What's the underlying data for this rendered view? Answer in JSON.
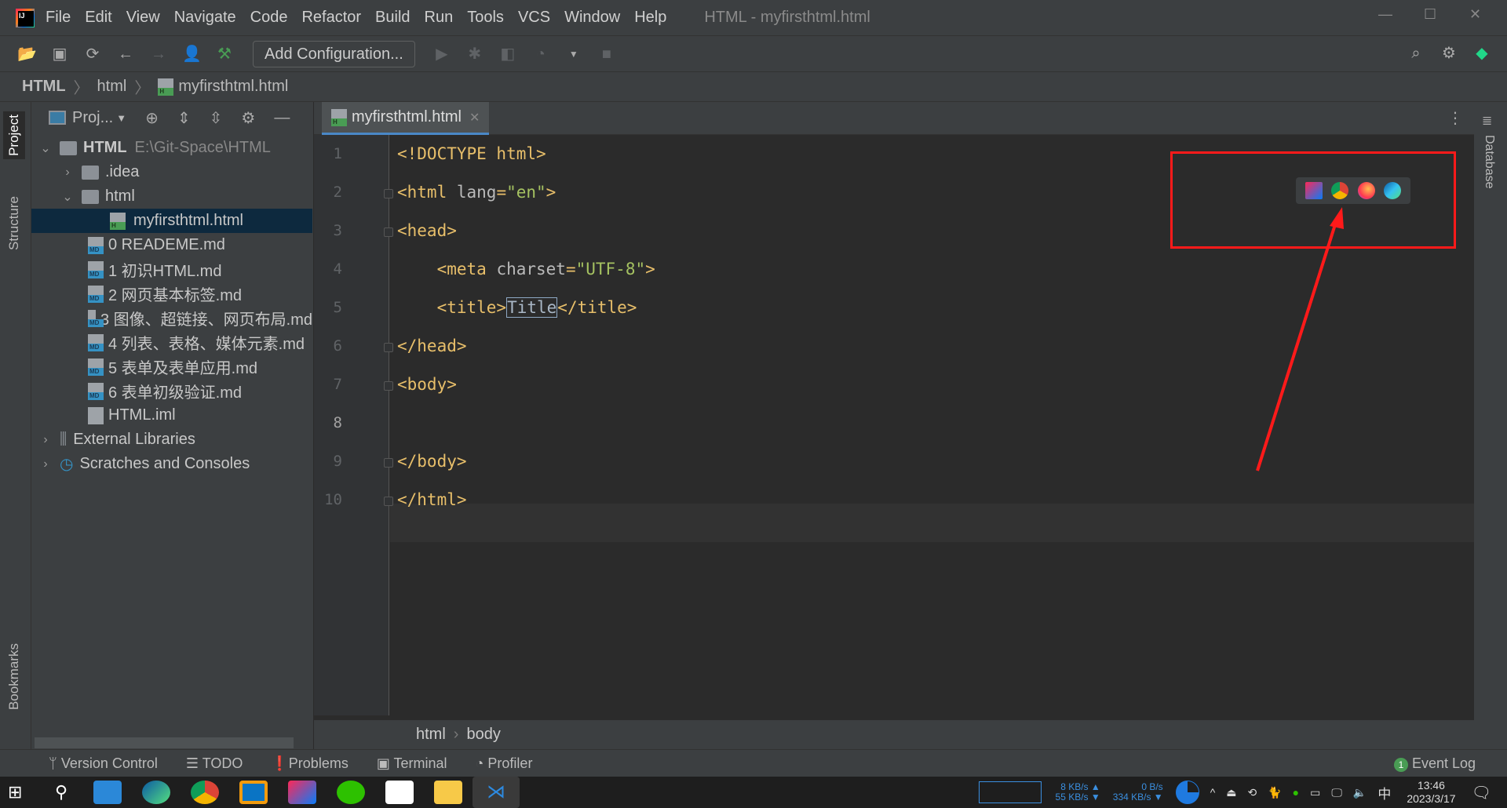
{
  "window": {
    "title": "HTML - myfirsthtml.html",
    "menu": [
      "File",
      "Edit",
      "View",
      "Navigate",
      "Code",
      "Refactor",
      "Build",
      "Run",
      "Tools",
      "VCS",
      "Window",
      "Help"
    ]
  },
  "toolbar": {
    "add_configuration": "Add Configuration..."
  },
  "navbar": {
    "crumbs": [
      "HTML",
      "html",
      "myfirsthtml.html"
    ]
  },
  "side_tabs": {
    "project": "Project",
    "structure": "Structure",
    "bookmarks": "Bookmarks",
    "database": "Database"
  },
  "project_panel": {
    "title": "Proj...",
    "tree": [
      {
        "label": "HTML",
        "path": "E:\\Git-Space\\HTML"
      },
      {
        "label": ".idea"
      },
      {
        "label": "html"
      },
      {
        "label": "myfirsthtml.html",
        "selected": true
      },
      {
        "label": "0 READEME.md"
      },
      {
        "label": "1 初识HTML.md"
      },
      {
        "label": "2 网页基本标签.md"
      },
      {
        "label": "3 图像、超链接、网页布局.md"
      },
      {
        "label": "4 列表、表格、媒体元素.md"
      },
      {
        "label": "5 表单及表单应用.md"
      },
      {
        "label": "6 表单初级验证.md"
      },
      {
        "label": "HTML.iml"
      },
      {
        "label": "External Libraries"
      },
      {
        "label": "Scratches and Consoles"
      }
    ]
  },
  "editor": {
    "tab": "myfirsthtml.html",
    "current_line": 8,
    "lines": [
      "<!DOCTYPE html>",
      "<html lang=\"en\">",
      "<head>",
      "    <meta charset=\"UTF-8\">",
      "    <title>Title</title>",
      "</head>",
      "<body>",
      "",
      "</body>",
      "</html>"
    ],
    "breadcrumb": [
      "html",
      "body"
    ],
    "browser_icons": [
      "intellij-icon",
      "chrome-icon",
      "firefox-icon",
      "edge-icon"
    ]
  },
  "bottom_tools": [
    "Version Control",
    "TODO",
    "Problems",
    "Terminal",
    "Profiler"
  ],
  "event_log": {
    "label": "Event Log",
    "count": "1"
  },
  "tray": {
    "up": "8 KB/s ▲",
    "down": "55 KB/s ▼",
    "up2": "0 B/s",
    "down2": "334 KB/s ▼",
    "ime": "中",
    "time": "13:46",
    "date": "2023/3/17"
  },
  "colors": {
    "accent": "#4a88c7",
    "annotation": "#ff1a1a",
    "selection": "#0d293e"
  }
}
